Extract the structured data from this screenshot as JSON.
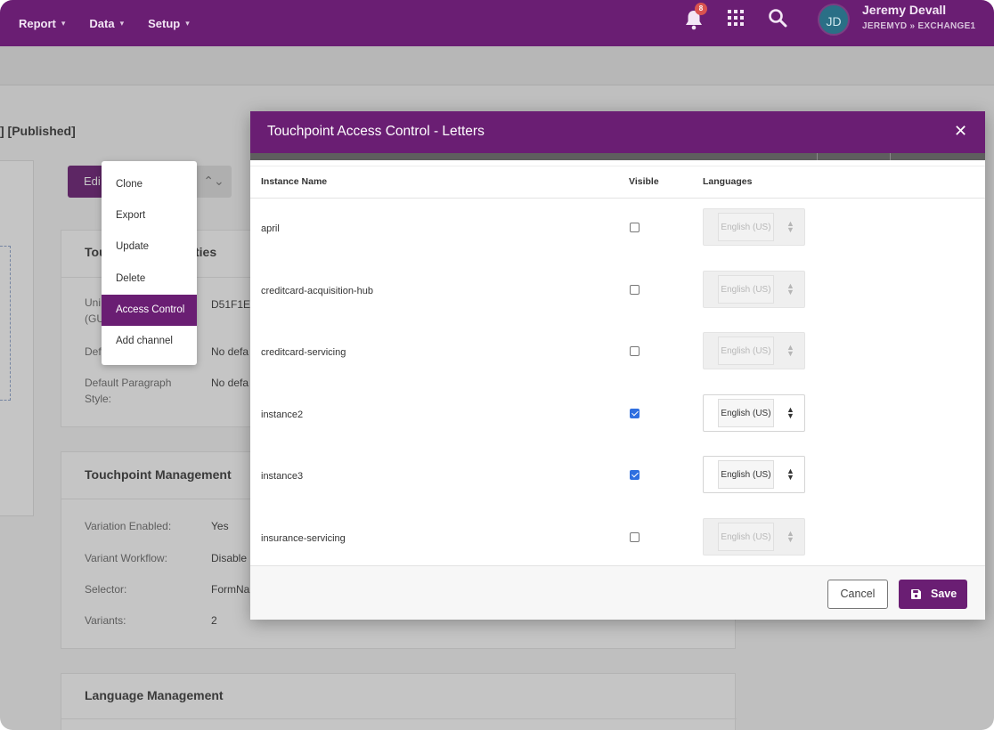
{
  "nav": {
    "items": [
      {
        "label": "Report",
        "chevron": "▾"
      },
      {
        "label": "Data",
        "chevron": "▾"
      },
      {
        "label": "Setup",
        "chevron": "▾"
      }
    ],
    "notifications_count": "8",
    "user": {
      "initials": "JD",
      "name": "Jeremy Devall",
      "path": "JEREMYD  »  EXCHANGE1"
    },
    "icons": [
      "bell-icon",
      "apps-grid-icon",
      "search-icon"
    ],
    "accent_color": "#6a1e73"
  },
  "page": {
    "title_fragment": "] [Published]",
    "edit_label": "Edi",
    "edit_caret": "⌃⌄",
    "properties_card": {
      "title_left": "Tou",
      "title_right": "ties",
      "rows": [
        {
          "label": "Uni\n(GU",
          "value": "D51F1E"
        },
        {
          "label": "Def",
          "value": "No defa"
        },
        {
          "label": "Default Paragraph\nStyle:",
          "value": "No defa"
        }
      ]
    },
    "management_card": {
      "title": "Touchpoint Management",
      "rows": [
        {
          "label": "Variation Enabled:",
          "value": "Yes"
        },
        {
          "label": "Variant Workflow:",
          "value": "Disable"
        },
        {
          "label": "Selector:",
          "value": "FormNa"
        },
        {
          "label": "Variants:",
          "value": "2"
        }
      ]
    },
    "language_card": {
      "title": "Language Management"
    }
  },
  "context_menu": {
    "items": [
      "Clone",
      "Export",
      "Update",
      "Delete",
      "Access Control",
      "Add channel"
    ],
    "active": "Access Control"
  },
  "modal": {
    "title": "Touchpoint Access Control - Letters",
    "close_label": "✕",
    "columns": [
      "Instance Name",
      "Visible",
      "Languages"
    ],
    "rows": [
      {
        "name": "april",
        "visible": false,
        "language": "English (US)"
      },
      {
        "name": "creditcard-acquisition-hub",
        "visible": false,
        "language": "English (US)"
      },
      {
        "name": "creditcard-servicing",
        "visible": false,
        "language": "English (US)"
      },
      {
        "name": "instance2",
        "visible": true,
        "language": "English (US)"
      },
      {
        "name": "instance3",
        "visible": true,
        "language": "English (US)"
      },
      {
        "name": "insurance-servicing",
        "visible": false,
        "language": "English (US)"
      }
    ],
    "cancel_label": "Cancel",
    "save_label": "Save",
    "checkbox_checked_color": "#2f6fe0"
  }
}
